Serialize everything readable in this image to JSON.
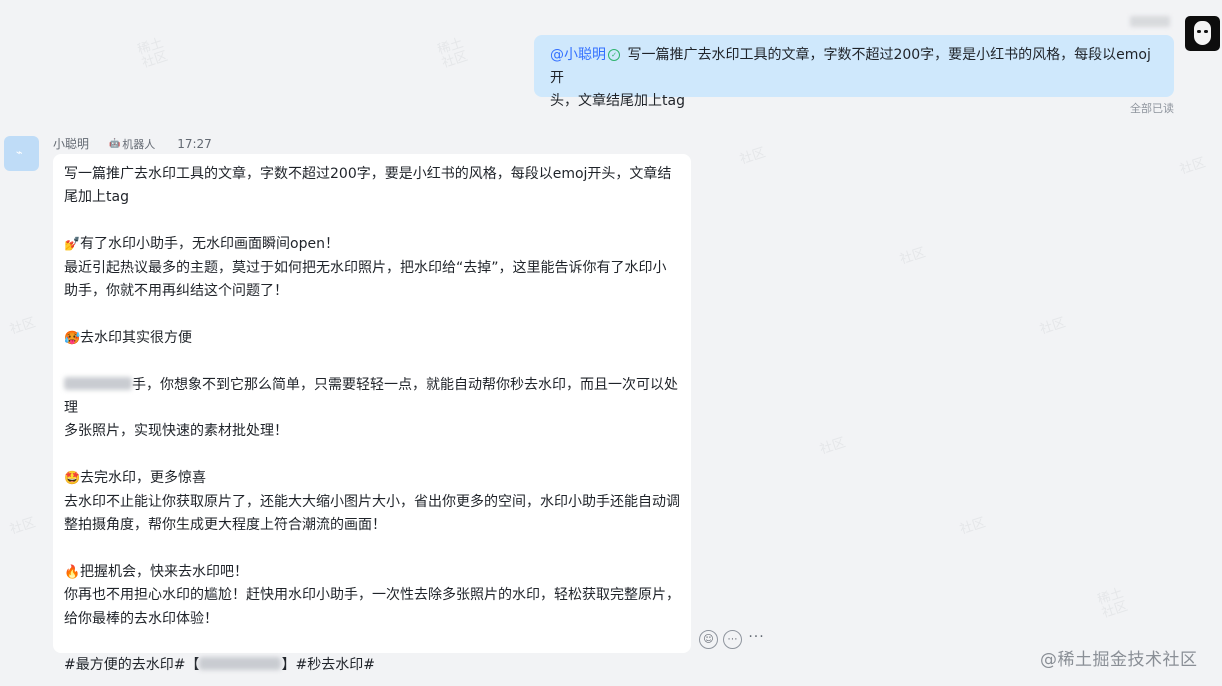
{
  "sent_message": {
    "mention": "@小聪明",
    "line1": " 写一篇推广去水印工具的文章，字数不超过200字，要是小红书的风格，每段以emoj开",
    "line2": "头，文章结尾加上tag",
    "read_status": "全部已读"
  },
  "bot_message": {
    "sender_name": "小聪明",
    "badge": "机器人",
    "time": "17:27",
    "paragraphs": [
      {
        "lines": [
          " 写一篇推广去水印工具的文章，字数不超过200字，要是小红书的风格，每段以emoj开头，文章结",
          "尾加上tag"
        ]
      },
      {
        "lines": [
          "有了水印小助手，无水印画面瞬间open！",
          "最近引起热议最多的主题，莫过于如何把无水印照片，把水印给“去掉”，这里能告诉你有了水印小",
          "助手，你就不用再纠结这个问题了！"
        ]
      },
      {
        "lines": [
          "去水印其实很方便"
        ]
      },
      {
        "lines": [
          "手，你想象不到它那么简单，只需要轻轻一点，就能自动帮你秒去水印，而且一次可以处理",
          "多张照片，实现快速的素材批处理！"
        ]
      },
      {
        "lines": [
          "去完水印，更多惊喜",
          "去水印不止能让你获取原片了，还能大大缩小图片大小，省出你更多的空间，水印小助手还能自动调",
          "整拍摄角度，帮你生成更大程度上符合潮流的画面！"
        ]
      },
      {
        "lines": [
          "把握机会，快来去水印吧！",
          "你再也不用担心水印的尴尬！赶快用水印小助手，一次性去除多张照片的水印，轻松获取完整原片，",
          "给你最棒的去水印体验！"
        ]
      }
    ],
    "tags": {
      "before": "#最方便的去水印#【",
      "after": "】#秒去水印#"
    }
  },
  "icons": {
    "emoji_1": "💅",
    "emoji_2": "🥵",
    "emoji_3": "🤩",
    "emoji_4": "🔥",
    "verified": "✓",
    "robot": "🤖",
    "reaction": "☺",
    "reply": "💬",
    "more": "···"
  },
  "watermark": {
    "site": "@稀土掘金技术社区"
  }
}
